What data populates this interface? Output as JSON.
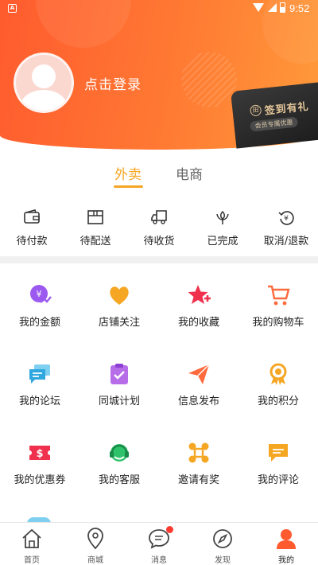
{
  "status_bar": {
    "time": "9:52",
    "app_icon": "A"
  },
  "header": {
    "login_text": "点击登录"
  },
  "signin_card": {
    "title": "签到有礼",
    "subtitle": "会员专属优惠"
  },
  "tabs": [
    {
      "label": "外卖",
      "active": true
    },
    {
      "label": "电商",
      "active": false
    }
  ],
  "orders": [
    {
      "label": "待付款",
      "icon": "wallet-icon"
    },
    {
      "label": "待配送",
      "icon": "package-icon"
    },
    {
      "label": "待收货",
      "icon": "truck-icon"
    },
    {
      "label": "已完成",
      "icon": "flower-icon"
    },
    {
      "label": "取消/退款",
      "icon": "refund-icon"
    }
  ],
  "grid": [
    {
      "label": "我的金额",
      "icon": "money-icon",
      "color": "#9b59f0"
    },
    {
      "label": "店铺关注",
      "icon": "heart-icon",
      "color": "#f5a623"
    },
    {
      "label": "我的收藏",
      "icon": "star-icon",
      "color": "#f0314e"
    },
    {
      "label": "我的购物车",
      "icon": "cart-icon",
      "color": "#ff6a3d"
    },
    {
      "label": "我的论坛",
      "icon": "chat-icon",
      "color": "#2fa8e0"
    },
    {
      "label": "同城计划",
      "icon": "clipboard-icon",
      "color": "#b76ce8"
    },
    {
      "label": "信息发布",
      "icon": "paper-plane-icon",
      "color": "#ff6a3d"
    },
    {
      "label": "我的积分",
      "icon": "medal-icon",
      "color": "#f5a623"
    },
    {
      "label": "我的优惠券",
      "icon": "coupon-icon",
      "color": "#f0314e"
    },
    {
      "label": "我的客服",
      "icon": "headset-icon",
      "color": "#2ec36b"
    },
    {
      "label": "邀请有奖",
      "icon": "network-icon",
      "color": "#f5a623"
    },
    {
      "label": "我的评论",
      "icon": "comment-icon",
      "color": "#f5a623"
    }
  ],
  "bottom_nav": [
    {
      "label": "首页",
      "icon": "home-icon"
    },
    {
      "label": "商城",
      "icon": "location-icon"
    },
    {
      "label": "消息",
      "icon": "message-icon",
      "badge": true
    },
    {
      "label": "发现",
      "icon": "compass-icon"
    },
    {
      "label": "我的",
      "icon": "profile-icon",
      "active": true
    }
  ],
  "colors": {
    "primary": "#ff5b2e",
    "accent": "#f5a623",
    "badge": "#ff3b30"
  }
}
